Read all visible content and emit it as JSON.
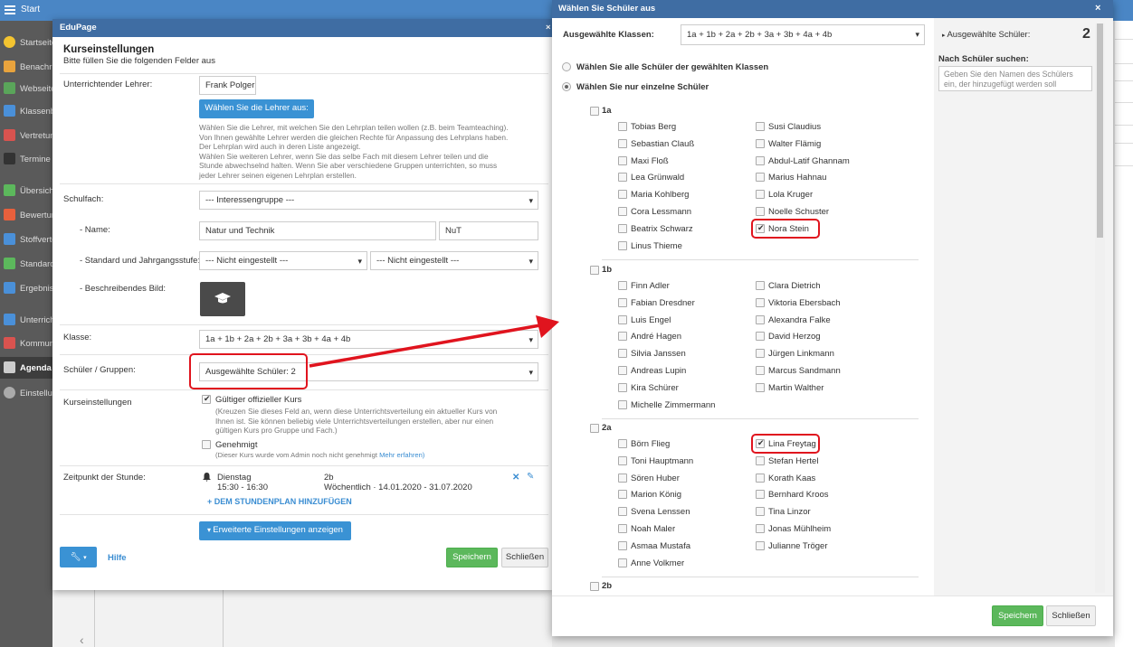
{
  "topbar": {
    "title": "Start"
  },
  "sidebar": {
    "items": [
      {
        "label": "Startseite",
        "icon": "star-icon",
        "color": "#f4c430"
      },
      {
        "label": "Benachrichtigungen",
        "icon": "mail-icon",
        "color": "#e8a33d"
      },
      {
        "label": "Webseite",
        "icon": "home-icon",
        "color": "#5aa55a"
      },
      {
        "label": "Klassenbuch",
        "icon": "book-icon",
        "color": "#4a90d9"
      },
      {
        "label": "Vertretungen",
        "icon": "person-icon",
        "color": "#d9534f"
      },
      {
        "label": "Termine",
        "icon": "calendar-icon",
        "color": "#333333"
      },
      {
        "label": "Übersicht",
        "icon": "check-circle-icon",
        "color": "#5cb85c"
      },
      {
        "label": "Bewertung",
        "icon": "grade-icon",
        "color": "#e8603c"
      },
      {
        "label": "Stoffverteilung",
        "icon": "list-icon",
        "color": "#4a90d9"
      },
      {
        "label": "Standards",
        "icon": "shield-icon",
        "color": "#5cb85c"
      },
      {
        "label": "Ergebnisse",
        "icon": "bar-chart-icon",
        "color": "#4a90d9"
      },
      {
        "label": "Unterricht",
        "icon": "monitor-icon",
        "color": "#4a90d9"
      },
      {
        "label": "Kommunikation",
        "icon": "chat-icon",
        "color": "#d9534f"
      },
      {
        "label": "Agenda",
        "icon": "agenda-icon",
        "color": "#cccccc"
      },
      {
        "label": "Einstellungen",
        "icon": "gear-icon",
        "color": "#aaaaaa"
      }
    ]
  },
  "course_dialog": {
    "window_title": "EduPage",
    "close": "×",
    "heading": "Kurseinstellungen",
    "subheading": "Bitte füllen Sie die folgenden Felder aus",
    "teacher_label": "Unterrichtender Lehrer:",
    "teacher_value": "Frank Polger",
    "choose_teacher_button": "Wählen Sie die Lehrer aus:",
    "teacher_help": [
      "Wählen Sie die Lehrer, mit welchen Sie den Lehrplan teilen wollen (z.B. beim Teamteaching).",
      "Von Ihnen gewählte Lehrer werden die gleichen Rechte für Anpassung des Lehrplans haben.",
      "Der Lehrplan wird auch in deren Liste angezeigt.",
      "Wählen Sie weiteren Lehrer, wenn Sie das selbe Fach mit diesem Lehrer teilen und die",
      "Stunde abwechselnd halten. Wenn Sie aber verschiedene Gruppen unterrichten, so muss",
      "jeder Lehrer seinen eigenen Lehrplan erstellen."
    ],
    "subject_label": "Schulfach:",
    "subject_value": "--- Interessengruppe ---",
    "name_label": "- Name:",
    "name_value": "Natur und Technik",
    "short_value": "NuT",
    "standard_label": "- Standard und Jahrgangsstufe:",
    "standard_value": "--- Nicht eingestellt ---",
    "grade_value": "--- Nicht eingestellt ---",
    "image_label": "- Beschreibendes Bild:",
    "class_label": "Klasse:",
    "class_value": "1a + 1b + 2a + 2b + 3a + 3b + 4a + 4b",
    "students_label": "Schüler / Gruppen:",
    "students_value": "Ausgewählte Schüler: 2",
    "course_settings_label": "Kurseinstellungen",
    "official_course_label": "Gültiger offizieller Kurs",
    "official_course_help": [
      "(Kreuzen Sie dieses Feld an, wenn diese Unterrichtsverteilung ein aktueller Kurs von",
      "Ihnen ist. Sie können beliebig viele Unterrichtsverteilungen erstellen, aber nur einen",
      "gültigen Kurs pro Gruppe und Fach.)"
    ],
    "approved_label": "Genehmigt",
    "approved_help": "(Dieser Kurs wurde vom Admin noch nicht genehmigt",
    "learn_more": "Mehr erfahren)",
    "lesson_time_label": "Zeitpunkt der Stunde:",
    "lesson_day": "Dienstag",
    "lesson_time": "15:30 - 16:30",
    "lesson_class": "2b",
    "lesson_period": "Wöchentlich · 14.01.2020 - 31.07.2020",
    "add_to_timetable": "+ DEM STUNDENPLAN HINZUFÜGEN",
    "advanced_button": "Erweiterte Einstellungen anzeigen",
    "help_link": "Hilfe",
    "save_button": "Speichern",
    "close_button": "Schließen"
  },
  "student_dialog": {
    "title": "Wählen Sie Schüler aus",
    "close": "×",
    "classes_label": "Ausgewählte Klassen:",
    "classes_value": "1a + 1b + 2a + 2b + 3a + 3b + 4a + 4b",
    "option_all": "Wählen Sie alle Schüler der gewählten Klassen",
    "option_single": "Wählen Sie nur einzelne Schüler",
    "classes": [
      {
        "name": "1a",
        "students": [
          {
            "name": "Tobias Berg",
            "checked": false
          },
          {
            "name": "Susi Claudius",
            "checked": false
          },
          {
            "name": "Sebastian Clauß",
            "checked": false
          },
          {
            "name": "Walter Flämig",
            "checked": false
          },
          {
            "name": "Maxi Floß",
            "checked": false
          },
          {
            "name": "Abdul-Latif Ghannam",
            "checked": false
          },
          {
            "name": "Lea Grünwald",
            "checked": false
          },
          {
            "name": "Marius Hahnau",
            "checked": false
          },
          {
            "name": "Maria Kohlberg",
            "checked": false
          },
          {
            "name": "Lola Kruger",
            "checked": false
          },
          {
            "name": "Cora Lessmann",
            "checked": false
          },
          {
            "name": "Noelle Schuster",
            "checked": false
          },
          {
            "name": "Beatrix Schwarz",
            "checked": false
          },
          {
            "name": "Nora Stein",
            "checked": true
          },
          {
            "name": "Linus Thieme",
            "checked": false
          }
        ]
      },
      {
        "name": "1b",
        "students": [
          {
            "name": "Finn Adler",
            "checked": false
          },
          {
            "name": "Clara Dietrich",
            "checked": false
          },
          {
            "name": "Fabian Dresdner",
            "checked": false
          },
          {
            "name": "Viktoria Ebersbach",
            "checked": false
          },
          {
            "name": "Luis Engel",
            "checked": false
          },
          {
            "name": "Alexandra Falke",
            "checked": false
          },
          {
            "name": "André Hagen",
            "checked": false
          },
          {
            "name": "David Herzog",
            "checked": false
          },
          {
            "name": "Silvia Janssen",
            "checked": false
          },
          {
            "name": "Jürgen Linkmann",
            "checked": false
          },
          {
            "name": "Andreas Lupin",
            "checked": false
          },
          {
            "name": "Marcus Sandmann",
            "checked": false
          },
          {
            "name": "Kira Schürer",
            "checked": false
          },
          {
            "name": "Martin Walther",
            "checked": false
          },
          {
            "name": "Michelle Zimmermann",
            "checked": false
          }
        ]
      },
      {
        "name": "2a",
        "students": [
          {
            "name": "Börn Flieg",
            "checked": false
          },
          {
            "name": "Lina Freytag",
            "checked": true
          },
          {
            "name": "Toni Hauptmann",
            "checked": false
          },
          {
            "name": "Stefan Hertel",
            "checked": false
          },
          {
            "name": "Sören Huber",
            "checked": false
          },
          {
            "name": "Korath Kaas",
            "checked": false
          },
          {
            "name": "Marion König",
            "checked": false
          },
          {
            "name": "Bernhard Kroos",
            "checked": false
          },
          {
            "name": "Svena Lenssen",
            "checked": false
          },
          {
            "name": "Tina Linzor",
            "checked": false
          },
          {
            "name": "Noah Maler",
            "checked": false
          },
          {
            "name": "Jonas Mühlheim",
            "checked": false
          },
          {
            "name": "Asmaa Mustafa",
            "checked": false
          },
          {
            "name": "Julianne Tröger",
            "checked": false
          },
          {
            "name": "Anne Volkmer",
            "checked": false
          }
        ]
      },
      {
        "name": "2b",
        "students": []
      }
    ],
    "selected_label": "Ausgewählte Schüler:",
    "selected_count": "2",
    "search_label": "Nach Schüler suchen:",
    "search_placeholder": "Geben Sie den Namen des Schülers ein, der hinzugefügt werden soll",
    "save_button": "Speichern",
    "close_button": "Schließen"
  },
  "colors": {
    "header": "#3f6da3",
    "topbar": "#4a86c5",
    "accent": "#3a92d4",
    "save": "#5cb85c",
    "highlight": "#e0141e"
  }
}
